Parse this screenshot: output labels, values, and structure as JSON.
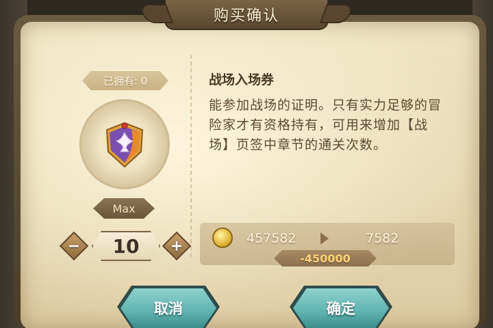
{
  "dialog": {
    "title": "购买确认"
  },
  "item": {
    "owned_label": "已拥有: 0",
    "name": "战场入场券",
    "description": "能参加战场的证明。只有实力足够的冒险家才有资格持有，可用来增加【战场】页签中章节的通关次数。",
    "icon": "battlefield-ticket-medal-icon"
  },
  "quantity": {
    "max_label": "Max",
    "value": "10",
    "minus_label": "−",
    "plus_label": "+"
  },
  "cost": {
    "currency_icon": "gold-coin-icon",
    "from": "457582",
    "to": "7582",
    "delta": "-450000"
  },
  "buttons": {
    "cancel": "取消",
    "confirm": "确定"
  },
  "colors": {
    "parchment": "#efe3c3",
    "frame": "#5a4630",
    "button": "#5fb2b0",
    "delta_text": "#ffd27a"
  }
}
